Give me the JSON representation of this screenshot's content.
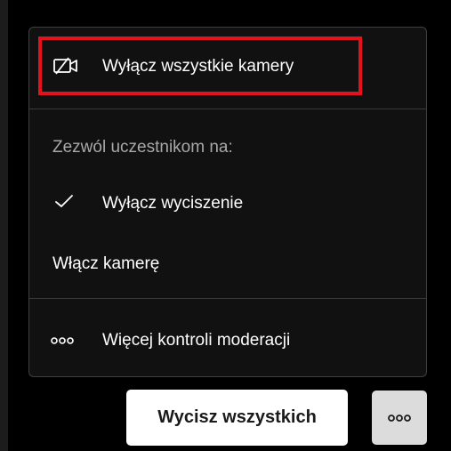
{
  "menu": {
    "disable_all_cameras": {
      "label": "Wyłącz wszystkie kamery",
      "icon": "camera-off-icon",
      "highlighted": true
    },
    "section_label": "Zezwól uczestnikom na:",
    "allow_unmute": {
      "label": "Wyłącz wyciszenie",
      "icon": "checkmark-icon",
      "checked": true
    },
    "allow_camera": {
      "label": "Włącz kamerę",
      "checked": false
    },
    "more_moderation": {
      "label": "Więcej kontroli moderacji",
      "icon": "more-dots-icon"
    }
  },
  "footer": {
    "mute_all_label": "Wycisz wszystkich",
    "more_button_icon": "more-dots-icon"
  },
  "colors": {
    "background": "#000000",
    "menu_background": "#111111",
    "highlight": "#e3121b",
    "primary_button": "#ffffff",
    "more_button": "#dcdcdc"
  }
}
